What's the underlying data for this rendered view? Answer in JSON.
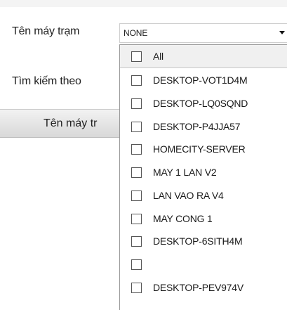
{
  "form": {
    "station_label": "Tên máy trạm",
    "search_label": "Tìm kiếm theo",
    "station_select_value": "NONE"
  },
  "grid": {
    "header_label": "Tên máy tr"
  },
  "dropdown": {
    "options": [
      {
        "label": "All",
        "checked": false,
        "highlighted": true
      },
      {
        "label": "DESKTOP-VOT1D4M",
        "checked": false
      },
      {
        "label": "DESKTOP-LQ0SQND",
        "checked": false
      },
      {
        "label": "DESKTOP-P4JJA57",
        "checked": false
      },
      {
        "label": "HOMECITY-SERVER",
        "checked": false
      },
      {
        "label": "MAY 1 LAN V2",
        "checked": false
      },
      {
        "label": "LAN VAO RA V4",
        "checked": false
      },
      {
        "label": "MAY CONG 1",
        "checked": false
      },
      {
        "label": "DESKTOP-6SITH4M",
        "checked": false
      },
      {
        "label": "",
        "checked": false
      },
      {
        "label": "DESKTOP-PEV974V",
        "checked": false
      }
    ]
  }
}
